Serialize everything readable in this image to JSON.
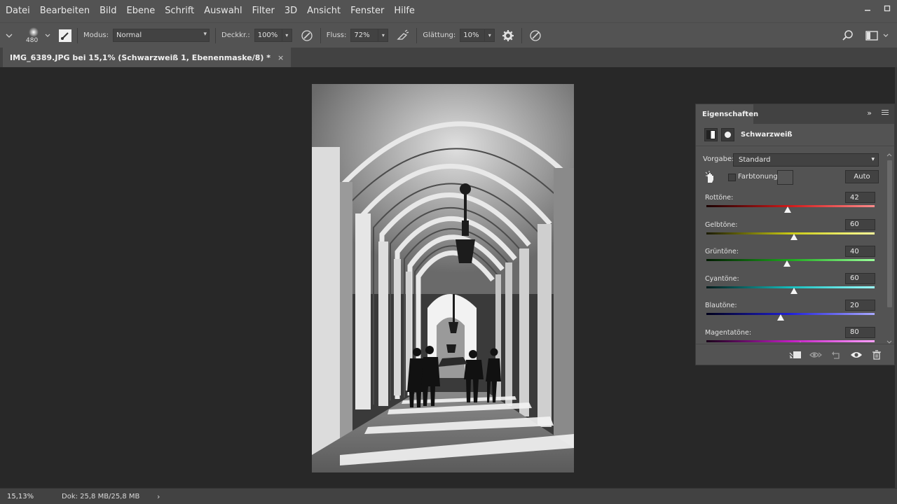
{
  "menu": [
    "Datei",
    "Bearbeiten",
    "Bild",
    "Ebene",
    "Schrift",
    "Auswahl",
    "Filter",
    "3D",
    "Ansicht",
    "Fenster",
    "Hilfe"
  ],
  "options": {
    "brush_size": "480",
    "mode_label": "Modus:",
    "mode_value": "Normal",
    "opacity_label": "Deckkr.:",
    "opacity_value": "100%",
    "flow_label": "Fluss:",
    "flow_value": "72%",
    "smoothing_label": "Glättung:",
    "smoothing_value": "10%"
  },
  "document": {
    "tab_title": "IMG_6389.JPG bei 15,1% (Schwarzweiß 1, Ebenenmaske/8) *",
    "close": "×"
  },
  "properties": {
    "panel_title": "Eigenschaften",
    "collapse": "»",
    "adjustment_title": "Schwarzweiß",
    "preset_label": "Vorgabe:",
    "preset_value": "Standard",
    "tint_label": "Farbtonung",
    "tint_checked": false,
    "auto_label": "Auto",
    "sliders": [
      {
        "label": "Rottöne:",
        "value": "42",
        "level": 42,
        "gradient": [
          "#1a0000",
          "#d11a1a",
          "#ff8a8a"
        ]
      },
      {
        "label": "Gelbtöne:",
        "value": "60",
        "level": 60,
        "gradient": [
          "#1a1a00",
          "#c9c914",
          "#ffff9a"
        ]
      },
      {
        "label": "Grüntöne:",
        "value": "40",
        "level": 40,
        "gradient": [
          "#001a00",
          "#1ea81e",
          "#9aff9a"
        ]
      },
      {
        "label": "Cyantöne:",
        "value": "60",
        "level": 60,
        "gradient": [
          "#001a1a",
          "#16bdbd",
          "#9affff"
        ]
      },
      {
        "label": "Blautöne:",
        "value": "20",
        "level": 20,
        "gradient": [
          "#00001a",
          "#2020d8",
          "#a8a8ff"
        ]
      },
      {
        "label": "Magentatöne:",
        "value": "80",
        "level": 80,
        "gradient": [
          "#1a001a",
          "#c21cc2",
          "#ffa0ff"
        ]
      }
    ]
  },
  "status": {
    "zoom": "15,13%",
    "doc_size": "Dok: 25,8 MB/25,8 MB",
    "arrow": "›"
  },
  "colors": {
    "panel_bg": "#535353",
    "canvas_bg": "#282828",
    "chrome_dark": "#424242"
  }
}
